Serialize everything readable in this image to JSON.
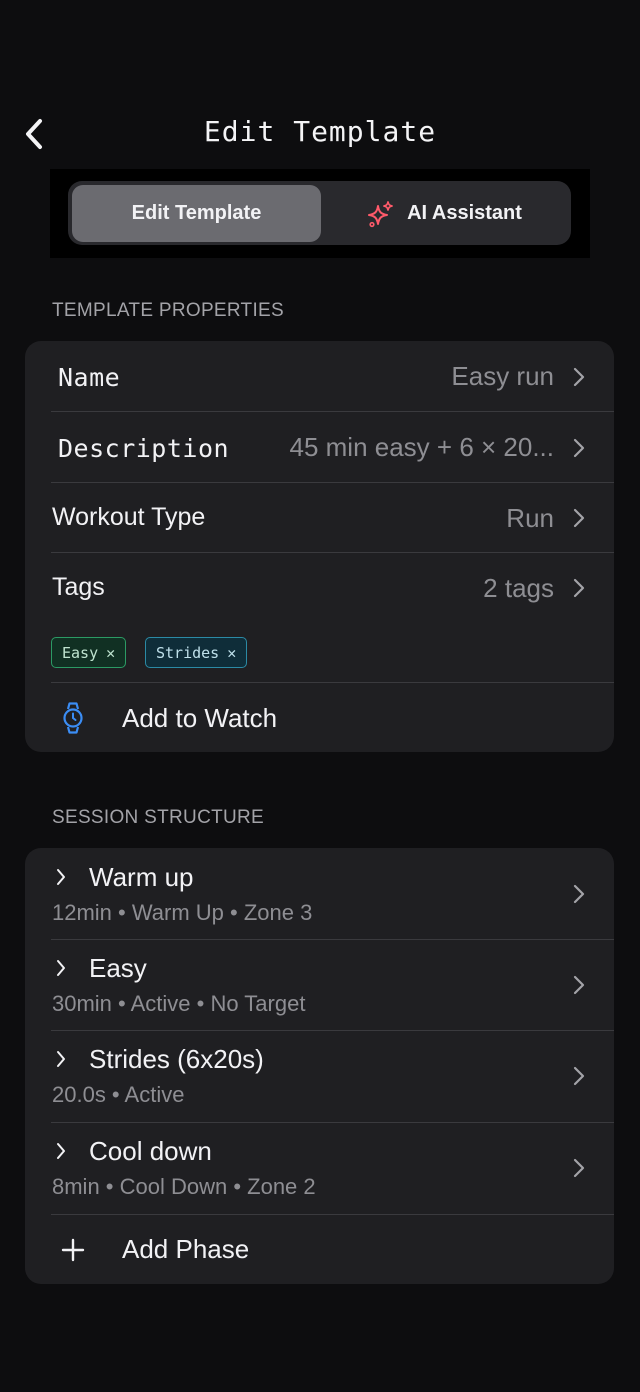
{
  "nav": {
    "title": "Edit Template"
  },
  "segmented": {
    "tab_edit": "Edit Template",
    "tab_ai": "AI Assistant",
    "selected": "Edit Template"
  },
  "properties": {
    "header": "TEMPLATE PROPERTIES",
    "name": {
      "label": "Name",
      "value": "Easy run"
    },
    "description": {
      "label": "Description",
      "value": "45 min easy + 6 × 20..."
    },
    "workout_type": {
      "label": "Workout Type",
      "value": "Run"
    },
    "tags": {
      "label": "Tags",
      "value": "2 tags",
      "items": [
        "Easy",
        "Strides"
      ]
    },
    "add_to_watch": "Add to Watch"
  },
  "session": {
    "header": "SESSION STRUCTURE",
    "phases": [
      {
        "title": "Warm up",
        "subtitle": "12min • Warm Up • Zone 3"
      },
      {
        "title": "Easy",
        "subtitle": "30min • Active • No Target"
      },
      {
        "title": "Strides (6x20s)",
        "subtitle": "20.0s • Active"
      },
      {
        "title": "Cool down",
        "subtitle": "8min • Cool Down • Zone 2"
      }
    ],
    "add_phase": "Add Phase"
  },
  "colors": {
    "background": "#0d0d0f",
    "card": "#1f1f22",
    "accent_blue": "#3b8df5",
    "ai_sparkle": "#ff5a6a",
    "tag_green": "#2b9a64",
    "tag_teal": "#2b8aa5"
  },
  "icons": {
    "back": "chevron-left-icon",
    "ai": "sparkles-icon",
    "watch": "watch-icon",
    "add": "plus-icon",
    "row_chevron": "chevron-right-icon"
  }
}
